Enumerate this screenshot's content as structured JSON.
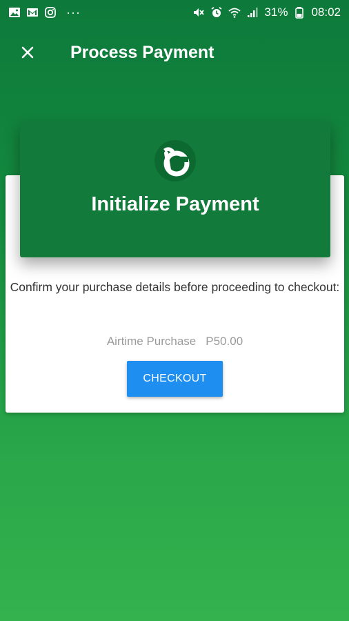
{
  "status_bar": {
    "battery_percent": "31%",
    "time": "08:02",
    "left_icons": [
      "gallery-icon",
      "gmail-icon",
      "instagram-icon",
      "more-dots-icon"
    ],
    "right_icons": [
      "mute-icon",
      "alarm-icon",
      "wifi-icon",
      "signal-icon",
      "battery-icon"
    ]
  },
  "app_bar": {
    "title": "Process Payment",
    "close_icon": "close-icon"
  },
  "header_card": {
    "title": "Initialize Payment",
    "logo_icon": "brand-logo-icon"
  },
  "body": {
    "confirm_text": "Confirm your purchase details before proceeding to checkout:",
    "item_name": "Airtime Purchase",
    "item_price": "P50.00"
  },
  "actions": {
    "checkout_label": "CHECKOUT"
  },
  "colors": {
    "header_green": "#127a3b",
    "checkout_blue": "#1e8ff0",
    "background_top": "#0d7a3b",
    "background_bottom": "#34b24e"
  }
}
